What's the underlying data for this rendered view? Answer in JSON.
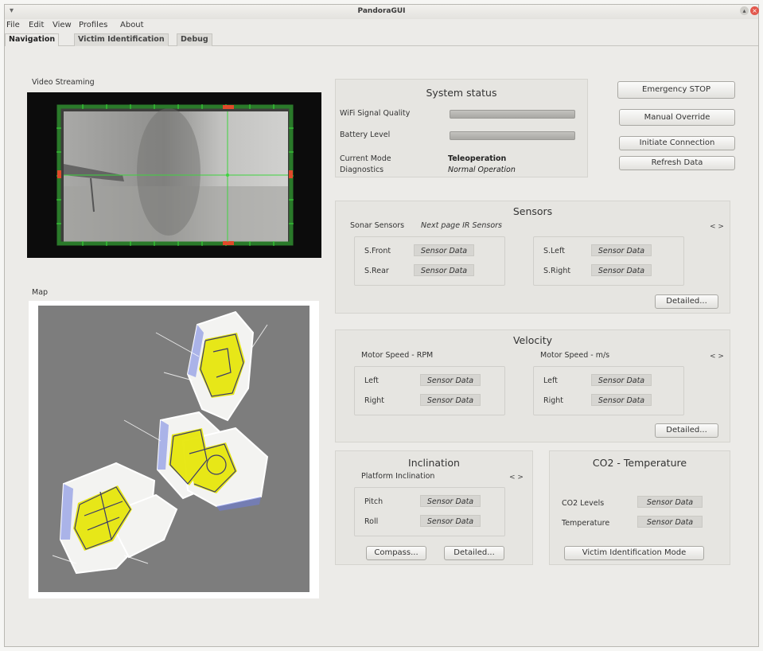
{
  "window": {
    "title": "PandoraGUI"
  },
  "menu": [
    "File",
    "Edit",
    "View",
    "Profiles",
    "About"
  ],
  "tabs": [
    "Navigation",
    "Victim Identification",
    "Debug"
  ],
  "video": {
    "label": "Video Streaming"
  },
  "map": {
    "label": "Map"
  },
  "system_status": {
    "title": "System status",
    "wifi_label": "WiFi Signal Quality",
    "battery_label": "Battery Level",
    "mode_label": "Current Mode",
    "mode_value": "Teleoperation",
    "diag_label": "Diagnostics",
    "diag_value": "Normal Operation"
  },
  "actions": {
    "emergency": "Emergency STOP",
    "override": "Manual Override",
    "connect": "Initiate Connection",
    "refresh": "Refresh Data"
  },
  "sensors": {
    "title": "Sensors",
    "sub_left": "Sonar Sensors",
    "sub_link": "Next page IR Sensors",
    "arrows": "< >",
    "front": "S.Front",
    "rear": "S.Rear",
    "left": "S.Left",
    "right": "S.Right",
    "data": "Sensor Data",
    "detailed": "Detailed..."
  },
  "velocity": {
    "title": "Velocity",
    "rpm": "Motor Speed - RPM",
    "ms": "Motor Speed - m/s",
    "arrows": "< >",
    "left": "Left",
    "right": "Right",
    "data": "Sensor Data",
    "detailed": "Detailed..."
  },
  "inclination": {
    "title": "Inclination",
    "sub": "Platform Inclination",
    "arrows": "< >",
    "pitch": "Pitch",
    "roll": "Roll",
    "data": "Sensor Data",
    "compass": "Compass...",
    "detailed": "Detailed..."
  },
  "co2": {
    "title": "CO2 - Temperature",
    "levels": "CO2 Levels",
    "temp": "Temperature",
    "data": "Sensor Data",
    "victim": "Victim Identification Mode"
  }
}
